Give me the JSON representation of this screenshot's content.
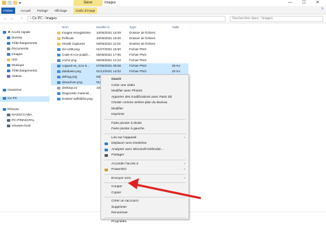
{
  "titlebar": {
    "manage_tab": "Gérer",
    "window_title": "Images",
    "minimize": "—",
    "maximize": "☐",
    "close": "✕"
  },
  "ribbon": {
    "tabs": [
      "Fichier",
      "Accueil",
      "Partage",
      "Affichage",
      "Outils d'image"
    ],
    "help_icon": "?"
  },
  "address": {
    "back": "←",
    "forward": "→",
    "up": "↑",
    "path": "›  Ce PC  ›  Images",
    "search_placeholder": "Rechercher dans : Images"
  },
  "sidebar": {
    "items": [
      {
        "label": "★ Accès rapide",
        "icon": "star-icon",
        "color": "#2f7fd1"
      },
      {
        "label": "Bureau",
        "icon": "desktop-icon",
        "color": "#2f7fd1"
      },
      {
        "label": "Téléchargements",
        "icon": "download-icon",
        "color": "#2f7fd1"
      },
      {
        "label": "Documents",
        "icon": "document-icon",
        "color": "#7a8ea6"
      },
      {
        "label": "Images",
        "icon": "images-icon",
        "color": "#2f7fd1"
      },
      {
        "label": "ISO",
        "icon": "folder-icon",
        "color": "#e8c25a"
      },
      {
        "label": "Musique",
        "icon": "music-icon",
        "color": "#2f7fd1"
      },
      {
        "label": "Téléchargements",
        "icon": "download-icon",
        "color": "#2f7fd1"
      },
      {
        "label": "Vidéos",
        "icon": "video-icon",
        "color": "#7a5fc4"
      },
      {
        "label": "OneDrive",
        "icon": "cloud-icon",
        "color": "#2f7fd1"
      },
      {
        "label": "Ce PC",
        "icon": "computer-icon",
        "color": "#2f7fd1"
      },
      {
        "label": "Réseau",
        "icon": "network-icon",
        "color": "#2f7fd1"
      },
      {
        "label": "NASSCCABA",
        "icon": "computer-icon",
        "color": "#5a6a7a"
      },
      {
        "label": "PC-PRINCIPAL",
        "icon": "computer-icon",
        "color": "#5a6a7a"
      },
      {
        "label": "vmware-host",
        "icon": "computer-icon",
        "color": "#5a6a7a"
      }
    ]
  },
  "columns": [
    "Nom",
    "Modifié le",
    "Type",
    "Taille"
  ],
  "files": [
    {
      "name": "Images enregistrées",
      "date": "10/06/2021 16:09",
      "type": "Dossier de fichiers",
      "size": "",
      "icon": "folder-icon",
      "color": "#e8c25a",
      "selected": false
    },
    {
      "name": "Pellicule",
      "date": "10/06/2021 16:00",
      "type": "Dossier de fichiers",
      "size": "",
      "icon": "folder-icon",
      "color": "#e8c25a",
      "selected": false
    },
    {
      "name": "Vivaldi Captures",
      "date": "03/06/2021 11:54",
      "type": "Dossier de fichiers",
      "size": "",
      "icon": "folder-icon",
      "color": "#e8c25a",
      "selected": false
    },
    {
      "name": "cle-USB.png",
      "date": "01/07/2021 15:50",
      "type": "Fichier PNG",
      "size": "",
      "icon": "image-file-icon",
      "color": "#3d8bd4",
      "selected": false
    },
    {
      "name": "Code-Ki-Ce-popkli...",
      "date": "05/08/2021 17:05",
      "type": "Fichier PNG",
      "size": "",
      "icon": "image-file-icon",
      "color": "#3d8bd4",
      "selected": false
    },
    {
      "name": "coche.png",
      "date": "05/08/2021 12:24",
      "type": "Fichier PNG",
      "size": "",
      "icon": "image-file-icon",
      "color": "#3d8bd4",
      "selected": false
    },
    {
      "name": "copped-vs_icon-5...",
      "date": "07/05/2021 09:08",
      "type": "Fichier PNG",
      "size": "26 Ko",
      "icon": "image-file-icon",
      "color": "#3d8bd4",
      "selected": true
    },
    {
      "name": "database.png",
      "date": "01/12/2021 14:02",
      "type": "Fichier PNG",
      "size": "25 Ko",
      "icon": "image-file-icon",
      "color": "#3d8bd4",
      "selected": true
    },
    {
      "name": "defrag.png",
      "date": "03/09/2021 15:03",
      "type": "Fichier PNG",
      "size": "",
      "icon": "image-file-icon",
      "color": "#3d8bd4",
      "selected": true
    },
    {
      "name": "desactiver.png",
      "date": "01/06/2021 11:45",
      "type": "Fichier PNG",
      "size": "",
      "icon": "image-file-icon",
      "color": "#3d8bd4",
      "selected": true
    },
    {
      "name": "desktop.ini",
      "date": "10/06/2021 16:00",
      "type": "",
      "size": "",
      "icon": "settings-file-icon",
      "color": "#9aa3ad",
      "selected": false
    },
    {
      "name": "Diagnostic-materiel...",
      "date": "",
      "type": "",
      "size": "",
      "icon": "image-file-icon",
      "color": "#3d8bd4",
      "selected": false
    },
    {
      "name": "Dossier-sdfsfdf34.png",
      "date": "",
      "type": "",
      "size": "",
      "icon": "image-file-icon",
      "color": "#3d8bd4",
      "selected": false
    }
  ],
  "context_menu": {
    "items": [
      {
        "label": "Ouvrir",
        "bold": true,
        "icon": "",
        "submenu": false,
        "sep_before": false
      },
      {
        "label": "Créer une vidéo",
        "icon": "",
        "submenu": false,
        "sep_before": false
      },
      {
        "label": "Modifier avec Photos",
        "icon": "",
        "submenu": false,
        "sep_before": false
      },
      {
        "label": "Apporter des modifications avec Paint 3D",
        "icon": "",
        "submenu": false,
        "sep_before": false
      },
      {
        "label": "Choisir comme arrière-plan du Bureau",
        "icon": "",
        "submenu": false,
        "sep_before": false
      },
      {
        "label": "Modifier",
        "icon": "",
        "submenu": false,
        "sep_before": false
      },
      {
        "label": "Imprimer",
        "icon": "",
        "submenu": false,
        "sep_before": false
      },
      {
        "label": "Faire pivoter à droite",
        "icon": "",
        "submenu": false,
        "sep_before": true
      },
      {
        "label": "Faire pivoter à gauche",
        "icon": "",
        "submenu": false,
        "sep_before": false
      },
      {
        "label": "Lire sur l'appareil",
        "icon": "",
        "submenu": true,
        "sep_before": true
      },
      {
        "label": "Déplacer vers OneDrive",
        "icon": "cloud-icon",
        "submenu": false,
        "sep_before": false
      },
      {
        "label": "Analyser avec Microsoft Defender...",
        "icon": "shield-icon",
        "submenu": false,
        "sep_before": false
      },
      {
        "label": "Partager",
        "icon": "share-icon",
        "submenu": false,
        "sep_before": false
      },
      {
        "label": "Accorder l'accès à",
        "icon": "",
        "submenu": true,
        "sep_before": true
      },
      {
        "label": "PowerISO",
        "icon": "poweriso-icon",
        "submenu": true,
        "sep_before": false
      },
      {
        "label": "Envoyer vers",
        "icon": "",
        "submenu": true,
        "sep_before": true
      },
      {
        "label": "Couper",
        "icon": "",
        "submenu": false,
        "sep_before": true
      },
      {
        "label": "Copier",
        "icon": "",
        "submenu": false,
        "sep_before": false
      },
      {
        "label": "Créer un raccourci",
        "icon": "",
        "submenu": false,
        "sep_before": true
      },
      {
        "label": "Supprimer",
        "icon": "",
        "submenu": false,
        "sep_before": false
      },
      {
        "label": "Renommer",
        "icon": "",
        "submenu": false,
        "sep_before": false
      },
      {
        "label": "Propriétés",
        "icon": "",
        "submenu": false,
        "sep_before": true
      }
    ],
    "submenu_arrow": "›"
  },
  "annotation": {
    "color": "#e02020"
  },
  "status": {
    "text": ""
  }
}
